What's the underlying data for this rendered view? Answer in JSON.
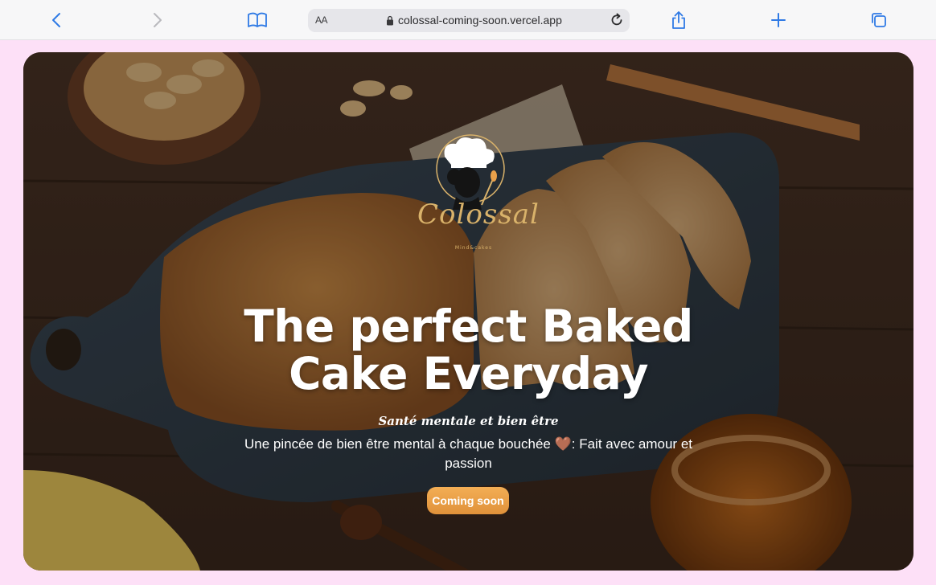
{
  "browser": {
    "text_size_label": "AA",
    "url": "colossal-coming-soon.vercel.app",
    "icons": [
      "back-icon",
      "forward-icon",
      "bookmarks-icon",
      "lock-icon",
      "reload-icon",
      "share-icon",
      "new-tab-icon",
      "tabs-overview-icon"
    ]
  },
  "hero": {
    "logo": {
      "script": "Colossal",
      "tagline": "Mind&cakes"
    },
    "headline": "The perfect Baked Cake Everyday",
    "subtitle": "Santé mentale et bien être",
    "description": "Une pincée de bien être mental à chaque bouchée 🤎: Fait avec amour et passion",
    "cta_label": "Coming soon"
  },
  "colors": {
    "page_background": "#fde0f7",
    "accent": "#e8a04a",
    "logo_gold": "#d9b26a",
    "toolbar_icon": "#1a73e8"
  }
}
